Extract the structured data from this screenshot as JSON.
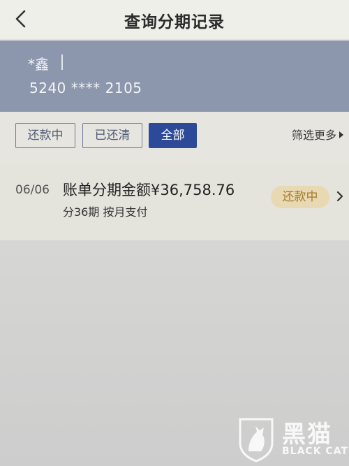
{
  "header": {
    "title": "查询分期记录",
    "back_icon": "chevron-left-icon"
  },
  "card": {
    "name": "*鑫",
    "number": "5240 **** 2105"
  },
  "filters": {
    "items": [
      {
        "label": "还款中",
        "active": false
      },
      {
        "label": "已还清",
        "active": false
      },
      {
        "label": "全部",
        "active": true
      }
    ],
    "more_label": "筛选更多"
  },
  "records": [
    {
      "date": "06/06",
      "title": "账单分期金额¥36,758.76",
      "subtitle": "分36期  按月支付",
      "status": "还款中"
    }
  ],
  "watermark": {
    "cn": "黑猫",
    "en": "BLACK CAT"
  },
  "colors": {
    "banner": "#8c96ad",
    "active_filter": "#2c4a97",
    "status_bg": "#e8d9b2",
    "status_text": "#a27b2f"
  }
}
